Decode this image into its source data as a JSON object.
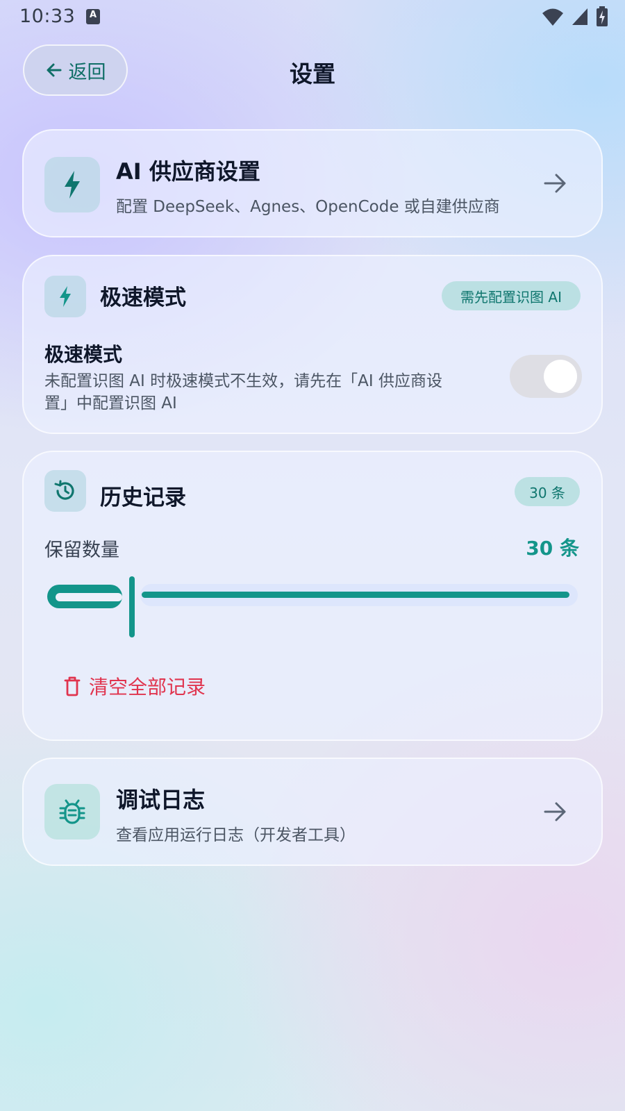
{
  "status_bar": {
    "time": "10:33",
    "notification_icon": "text-notification-icon",
    "icons": [
      "wifi-icon",
      "signal-icon",
      "battery-charging-icon"
    ]
  },
  "header": {
    "back_label": "返回",
    "title": "设置"
  },
  "ai_provider": {
    "title": "AI 供应商设置",
    "subtitle": "配置 DeepSeek、Agnes、OpenCode 或自建供应商"
  },
  "speed_mode": {
    "title": "极速模式",
    "badge": "需先配置识图 AI",
    "setting_label": "极速模式",
    "description_line1": "未配置识图 AI 时极速模式不生效，请先在「AI 供应商设",
    "description_line2": "置」中配置识图 AI",
    "toggle_on": false
  },
  "history": {
    "title": "历史记录",
    "badge": "30 条",
    "retain_label": "保留数量",
    "retain_value": "30 条",
    "slider_value": 30,
    "clear_label": "清空全部记录"
  },
  "debug_log": {
    "title": "调试日志",
    "subtitle": "查看应用运行日志（开发者工具）"
  },
  "colors": {
    "accent": "#13958a",
    "accent_text": "#0f766e",
    "danger": "#e0344e",
    "toggle_off": "#dedee4"
  }
}
